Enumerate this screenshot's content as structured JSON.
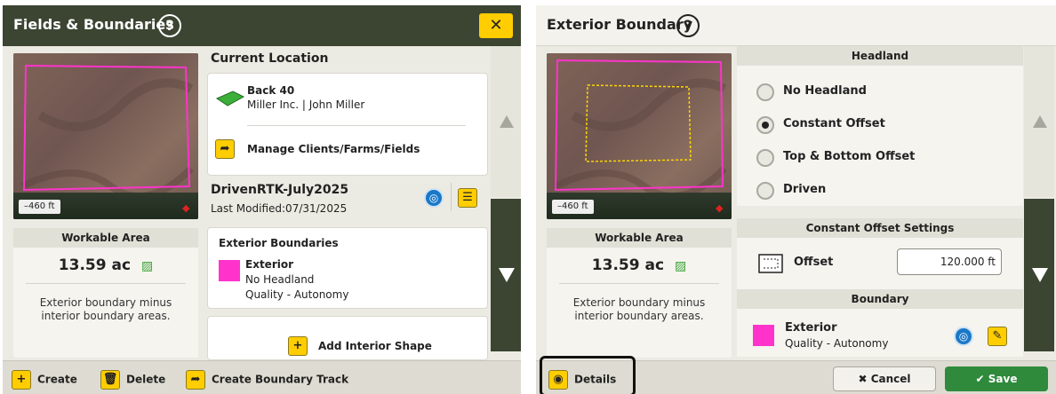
{
  "left": {
    "title": "Fields & Boundaries",
    "help": "?",
    "close": "✕",
    "map": {
      "scale": "460 ft"
    },
    "workable": {
      "title": "Workable Area",
      "value": "13.59 ac",
      "description": "Exterior boundary minus interior boundary areas."
    },
    "current_location": {
      "title": "Current Location",
      "field_name": "Back 40",
      "owner": "Miller Inc. | John Miller",
      "manage_label": "Manage Clients/Farms/Fields"
    },
    "boundary_set": {
      "name": "DrivenRTK-July2025",
      "modified": "Last Modified:07/31/2025"
    },
    "exterior": {
      "title": "Exterior Boundaries",
      "name": "Exterior",
      "headland": "No Headland",
      "quality": "Quality - Autonomy",
      "color": "#ff33cc"
    },
    "add_interior_label": "Add Interior Shape",
    "footer": {
      "create": "Create",
      "delete": "Delete",
      "create_track": "Create Boundary Track"
    }
  },
  "right": {
    "title": "Exterior Boundary",
    "help": "?",
    "map": {
      "scale": "460 ft"
    },
    "workable": {
      "title": "Workable Area",
      "value": "13.59 ac",
      "description": "Exterior boundary minus interior boundary areas."
    },
    "headland": {
      "title": "Headland",
      "options": [
        "No Headland",
        "Constant Offset",
        "Top & Bottom Offset",
        "Driven"
      ],
      "selected": "Constant Offset"
    },
    "offset_settings": {
      "title": "Constant Offset Settings",
      "label": "Offset",
      "value": "120.000 ft"
    },
    "boundary": {
      "title": "Boundary",
      "name": "Exterior",
      "quality": "Quality - Autonomy",
      "color": "#ff33cc"
    },
    "footer": {
      "details": "Details",
      "cancel": "Cancel",
      "save": "Save"
    }
  }
}
